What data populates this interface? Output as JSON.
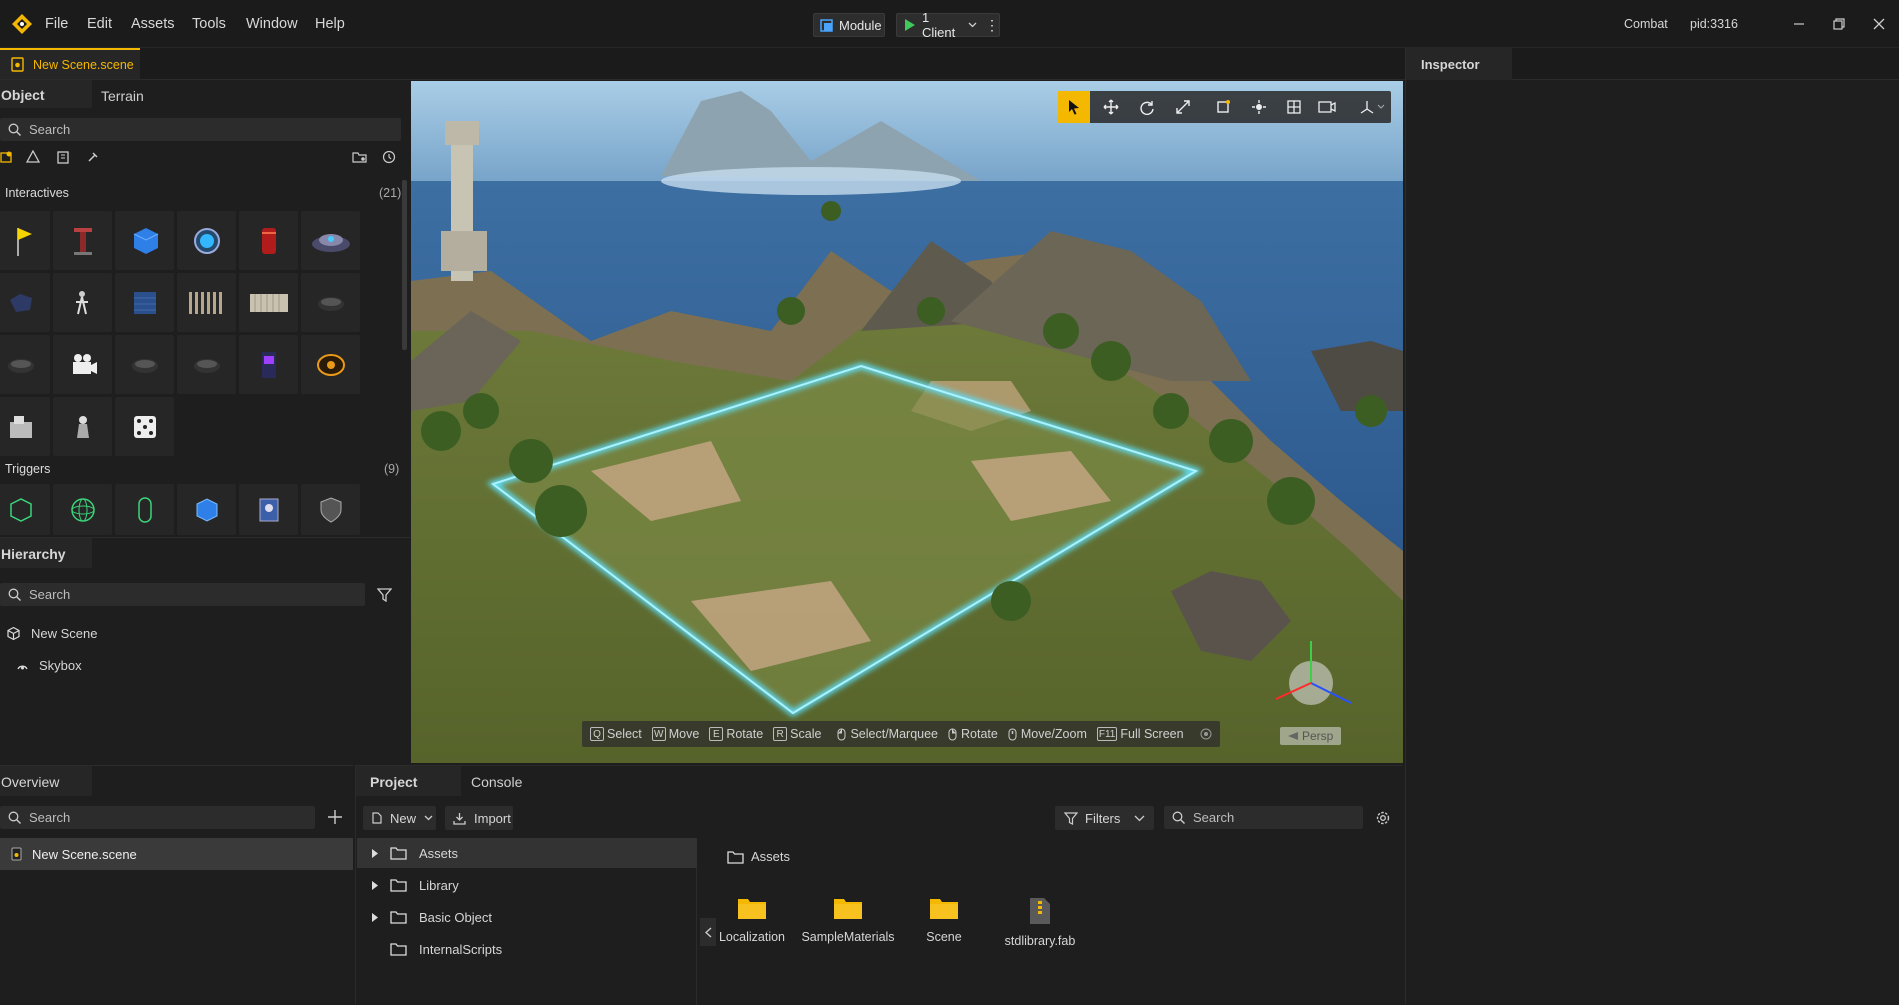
{
  "app": {
    "logo": "app-logo-icon"
  },
  "menu": [
    "File",
    "Edit",
    "Assets",
    "Tools",
    "Window",
    "Help"
  ],
  "toolbar": {
    "module_label": "Module",
    "play_label": "1 Client"
  },
  "titlebar_right": {
    "mode": "Combat",
    "pid": "pid:3316"
  },
  "document_tab": {
    "label": "New Scene.scene"
  },
  "inspector": {
    "title": "Inspector"
  },
  "object_panel": {
    "tabs": [
      "Object",
      "Terrain"
    ],
    "search_placeholder": "Search",
    "sections": [
      {
        "title": "Interactives",
        "count": "(21)"
      },
      {
        "title": "Triggers",
        "count": "(9)"
      }
    ]
  },
  "hierarchy": {
    "title": "Hierarchy",
    "search_placeholder": "Search",
    "items": [
      "New Scene",
      "Skybox"
    ]
  },
  "viewport": {
    "hints": [
      {
        "key": "Q",
        "label": "Select"
      },
      {
        "key": "W",
        "label": "Move"
      },
      {
        "key": "E",
        "label": "Rotate"
      },
      {
        "key": "R",
        "label": "Scale"
      },
      {
        "key": "",
        "label": "Select/Marquee"
      },
      {
        "key": "",
        "label": "Rotate"
      },
      {
        "key": "",
        "label": "Move/Zoom"
      },
      {
        "key": "F11",
        "label": "Full Screen"
      }
    ],
    "persp_label": "Persp",
    "colors": {
      "accent": "#f5b800",
      "selection": "#5ce1ff"
    }
  },
  "overview": {
    "title": "Overview",
    "search_placeholder": "Search",
    "item": "New Scene.scene"
  },
  "bottom_tabs": [
    "Project",
    "Console"
  ],
  "project": {
    "new_label": "New",
    "import_label": "Import",
    "filters_label": "Filters",
    "search_placeholder": "Search",
    "tree": [
      "Assets",
      "Library",
      "Basic Object",
      "InternalScripts"
    ],
    "breadcrumb": "Assets",
    "assets": [
      "Localization",
      "SampleMaterials",
      "Scene",
      "stdlibrary.fab"
    ]
  }
}
